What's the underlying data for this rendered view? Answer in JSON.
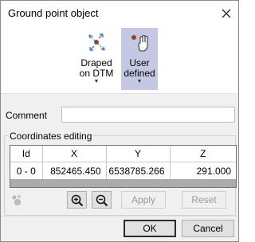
{
  "window": {
    "title": "Ground point object"
  },
  "ribbon": {
    "draped": {
      "line1": "Draped",
      "line2": "on DTM",
      "caret": "▼"
    },
    "user_defined": {
      "line1": "User",
      "line2": "defined",
      "caret": "▼",
      "selected": true
    }
  },
  "comment": {
    "label": "Comment",
    "value": ""
  },
  "coords": {
    "group_label": "Coordinates editing",
    "headers": [
      "Id",
      "X",
      "Y",
      "Z"
    ],
    "rows": [
      {
        "id": "0 - 0",
        "x": "852465.450",
        "y": "6538785.266",
        "z": "291.000"
      }
    ]
  },
  "toolbar": {
    "apply": "Apply",
    "reset": "Reset"
  },
  "footer": {
    "ok": "OK",
    "cancel": "Cancel"
  },
  "colors": {
    "selected": "#c5c8e2",
    "icon_brown": "#8b4a2b",
    "icon_blue": "#3a7bd5"
  }
}
